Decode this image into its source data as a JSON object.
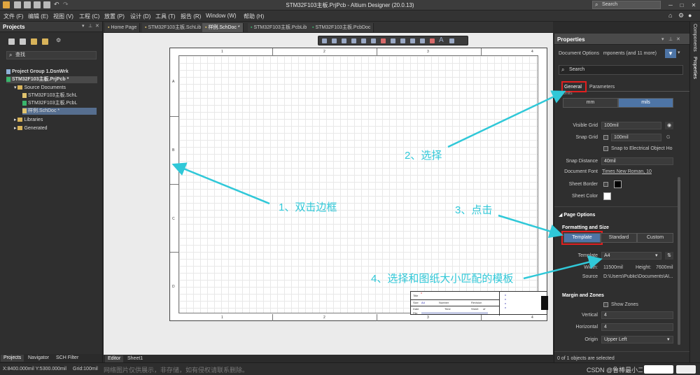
{
  "window": {
    "title": "STM32F103主板.PrjPcb - Altium Designer (20.0.13)",
    "search_placeholder": "Search"
  },
  "menu": [
    "文件 (F)",
    "编辑 (E)",
    "视图 (V)",
    "工程 (C)",
    "放置 (P)",
    "设计 (D)",
    "工具 (T)",
    "报告 (R)",
    "Window (W)",
    "帮助 (H)"
  ],
  "projects": {
    "title": "Projects",
    "search": "查找",
    "group": "Project Group 1.DsnWrk",
    "project": "STM32F103主板.PrjPcb *",
    "source": "Source Documents",
    "files": [
      "STM32F103主板.SchL",
      "STM32F103主板.PcbL",
      "样例.SchDoc *"
    ],
    "libraries": "Libraries",
    "generated": "Generated",
    "bottom_tabs": [
      "Projects",
      "Navigator",
      "SCH Filter"
    ]
  },
  "doc_tabs": [
    "Home Page",
    "STM32F103主板.SchLib",
    "样例.SchDoc *",
    "STM32F103主板.PcbLib",
    "STM32F103主板.PcbDoc"
  ],
  "sheet": {
    "cols": [
      "1",
      "2",
      "3",
      "4"
    ],
    "rows": [
      "A",
      "B",
      "C",
      "D"
    ],
    "title_block": {
      "title": "Title",
      "size": "Size",
      "size_val": "A4",
      "number": "Number",
      "revision": "Revision",
      "date": "Date",
      "time": "Time",
      "sheet": "Sheet",
      "of": "of",
      "file": "File"
    }
  },
  "editor_tabs": [
    "Editor",
    "Sheet1"
  ],
  "status": {
    "coords": "X:8400.000mil Y:5300.000mil",
    "grid": "Grid:100mil",
    "watermark": "网络图片仅供展示，非存储，如有侵权请联系删除。",
    "csdn": "CSDN @鲁棒最小二乘支持向量机",
    "objects": "0 of 1 objects are selected"
  },
  "right_strip": [
    "Components",
    "Properties"
  ],
  "properties": {
    "title": "Properties",
    "doc_options": "Document Options",
    "doc_options_rest": "mponents (and 11 more)",
    "search": "Search",
    "tabs": [
      "General",
      "Parameters"
    ],
    "units_label": "Units",
    "units": [
      "mm",
      "mils"
    ],
    "visible_grid_label": "Visible Grid",
    "visible_grid": "100mil",
    "snap_grid_label": "Snap Grid",
    "snap_grid": "100mil",
    "snap_grid_key": "G",
    "snap_electrical": "Snap to Electrical Object Ho",
    "snap_distance_label": "Snap Distance",
    "snap_distance": "40mil",
    "doc_font_label": "Document Font",
    "doc_font": "Times New Roman, 10",
    "sheet_border_label": "Sheet Border",
    "sheet_color_label": "Sheet Color",
    "page_options": "Page Options",
    "formatting": "Formatting and Size",
    "format_btns": [
      "Template",
      "Standard",
      "Custom"
    ],
    "template_label": "Template",
    "template": "A4",
    "width_label": "Width:",
    "width": "11500mil",
    "height_label": "Height:",
    "height": "7600mil",
    "source_label": "Source",
    "source": "D:\\Users\\Public\\Documents\\Al...",
    "margin": "Margin and Zones",
    "show_zones": "Show Zones",
    "vertical_label": "Vertical",
    "vertical": "4",
    "horizontal_label": "Horizontal",
    "horizontal": "4",
    "origin_label": "Origin",
    "origin": "Upper Left"
  },
  "annotations": [
    "1、双击边框",
    "2、选择",
    "3、点击",
    "4、选择和图纸大小匹配的模板"
  ],
  "colors": {
    "accent": "#30c8d8",
    "highlight": "#e02020",
    "selected": "#4e75a6"
  }
}
